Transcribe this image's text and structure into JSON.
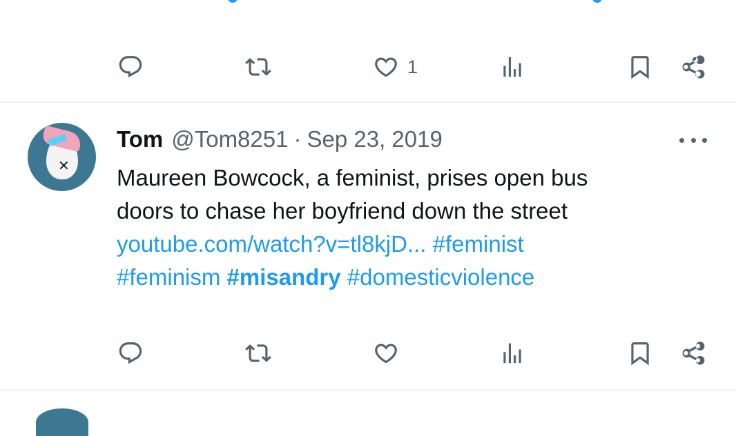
{
  "tweets": [
    {
      "actions": {
        "reply_count": "",
        "retweet_count": "",
        "like_count": "1",
        "view_count": ""
      }
    },
    {
      "author": {
        "name": "Tom",
        "handle": "@Tom8251"
      },
      "separator": "·",
      "date": "Sep 23, 2019",
      "text_line_1": "Maureen Bowcock, a feminist, prises open bus",
      "text_line_2": "doors to chase her boyfriend down the street",
      "link_url": "youtube.com/watch?v=tl8kjD...",
      "hashtags": {
        "h1": "#feminist",
        "h2": "#feminism",
        "h3": "#misandry",
        "h4": "#domesticviolence"
      },
      "actions": {
        "reply_count": "",
        "retweet_count": "",
        "like_count": "",
        "view_count": ""
      }
    }
  ],
  "icons": {
    "reply": "reply-icon",
    "retweet": "retweet-icon",
    "like": "heart-icon",
    "views": "views-icon",
    "bookmark": "bookmark-icon",
    "share": "share-icon",
    "more": "more-icon"
  },
  "colors": {
    "link": "#1d9bf0",
    "secondary_text": "#536471",
    "primary_text": "#0f1419",
    "divider": "#eff3f4",
    "avatar_bg": "#3d7892"
  }
}
